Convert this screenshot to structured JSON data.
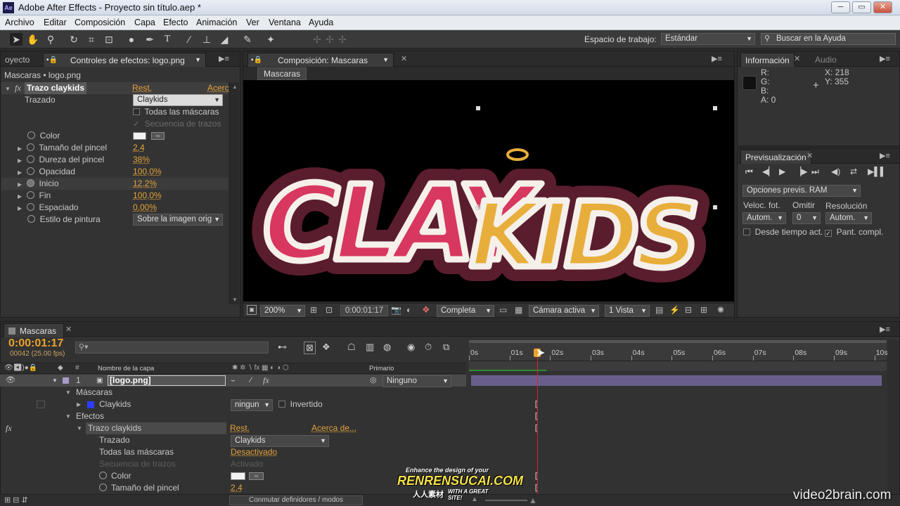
{
  "app": {
    "title": "Adobe After Effects - Proyecto sin título.aep *",
    "logo_text": "Ae",
    "window_buttons": [
      "─",
      "▭",
      "✕"
    ]
  },
  "menu": [
    "Archivo",
    "Editar",
    "Composición",
    "Capa",
    "Efecto",
    "Animación",
    "Ver",
    "Ventana",
    "Ayuda"
  ],
  "toolbar": {
    "workspace_label": "Espacio de trabajo:",
    "workspace_value": "Estándar",
    "search_placeholder": "Buscar en la Ayuda"
  },
  "effects_panel": {
    "tabs": [
      "oyecto",
      "Controles de efectos: logo.png"
    ],
    "breadcrumb": "Mascaras • logo.png",
    "effect_name": "Trazo claykids",
    "reset": "Rest.",
    "about": "Acerca",
    "trazado_label": "Trazado",
    "trazado_value": "Claykids",
    "todas_mascaras": "Todas las máscaras",
    "secuencia": "Secuencia de trazos",
    "props": [
      {
        "label": "Color",
        "value": ""
      },
      {
        "label": "Tamaño del pincel",
        "value": "2,4"
      },
      {
        "label": "Dureza del pincel",
        "value": "38%"
      },
      {
        "label": "Opacidad",
        "value": "100,0%"
      },
      {
        "label": "Inicio",
        "value": "12,2%"
      },
      {
        "label": "Fin",
        "value": "100,0%"
      },
      {
        "label": "Espaciado",
        "value": "0,00%"
      },
      {
        "label": "Estilo de pintura",
        "value": "Sobre la imagen orig"
      }
    ]
  },
  "composition": {
    "tab": "Composición: Mascaras",
    "subtab": "Mascaras",
    "logo_left": "CLAY",
    "logo_right": "KIDS",
    "footer": {
      "zoom": "200%",
      "timecode": "0:00:01:17",
      "quality": "Completa",
      "camera": "Cámara activa",
      "views": "1 Vista"
    }
  },
  "info_panel": {
    "tabs": [
      "Información",
      "Audio"
    ],
    "r": "R:",
    "g": "G:",
    "b": "B:",
    "a": "A: 0",
    "x": "X: 218",
    "y": "Y: 355"
  },
  "preview_panel": {
    "tab": "Previsualización",
    "ram_options": "Opciones previs. RAM",
    "fps_label": "Veloc. fot.",
    "fps_value": "Autom.",
    "skip_label": "Omitir",
    "skip_value": "0",
    "res_label": "Resolución",
    "res_value": "Autom.",
    "from_current": "Desde tiempo act.",
    "fullscreen": "Pant. compl."
  },
  "timeline": {
    "tab": "Mascaras",
    "timecode": "0:00:01:17",
    "frames": "00042 (25.00 fps)",
    "col_name": "Nombre de la capa",
    "col_parent": "Primario",
    "ruler": [
      "0s",
      "01s",
      "02s",
      "03s",
      "04s",
      "05s",
      "06s",
      "07s",
      "08s",
      "09s",
      "10s"
    ],
    "playhead_time": 1.68,
    "ruler_max": 10.3,
    "layer": {
      "num": "1",
      "name": "[logo.png]",
      "parent": "Ninguno"
    },
    "rows": {
      "mascaras": "Máscaras",
      "mask_name": "Claykids",
      "mask_mode": "ningun",
      "invertido": "Invertido",
      "efectos": "Efectos",
      "effect": "Trazo claykids",
      "reset": "Rest.",
      "about": "Acerca de...",
      "trazado": "Trazado",
      "trazado_value": "Claykids",
      "todas": "Todas las máscaras",
      "todas_value": "Desactivado",
      "secuencia": "Secuencia de trazos",
      "secuencia_value": "Activado",
      "color": "Color",
      "tamano": "Tamaño del pincel",
      "tamano_value": "2,4"
    },
    "footer_toggle": "Conmutar definidores / modos"
  },
  "watermarks": {
    "left_top": "Enhance the design of your",
    "left_main": "RENRENSUCAI.COM",
    "left_sub": "人人素材",
    "left_tag": "WITH A GREAT SITE!",
    "right": "video2brain.com"
  },
  "colors": {
    "accent": "#e2a23a",
    "mask_blue": "#2d3cff",
    "logo_pink": "#d8375f",
    "logo_yellow": "#e8ae3b",
    "logo_outline": "#5a1d2e",
    "layer_purple": "#6a5f8c"
  }
}
